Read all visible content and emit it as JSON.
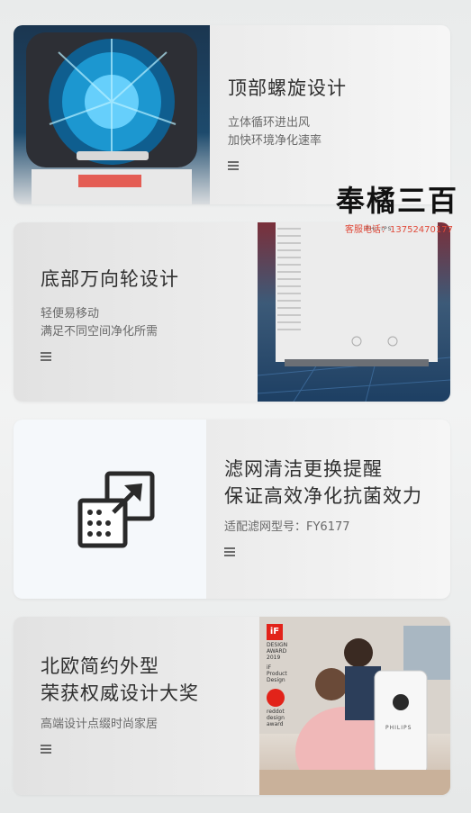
{
  "features": [
    {
      "title_lines": [
        "顶部螺旋设计"
      ],
      "desc_lines": [
        "立体循环进出风",
        "加快环境净化速率"
      ]
    },
    {
      "title_lines": [
        "底部万向轮设计"
      ],
      "desc_lines": [
        "轻便易移动",
        "满足不同空间净化所需"
      ]
    },
    {
      "title_lines": [
        "滤网清洁更换提醒",
        "保证高效净化抗菌效力"
      ],
      "desc_lines": [
        "适配滤网型号：FY6177"
      ]
    },
    {
      "title_lines": [
        "北欧简约外型",
        "荣获权威设计大奖"
      ],
      "desc_lines": [
        "高端设计点缀时尚家居"
      ]
    }
  ],
  "watermark": {
    "logo": "奉橘三百",
    "contact": "客服电话：13752470177"
  },
  "product_brand": "PHILIPS",
  "awards": {
    "if_mark": "iF",
    "if_lines": [
      "DESIGN",
      "AWARD",
      "2019"
    ],
    "if_product": [
      "iF",
      "Product",
      "Design"
    ],
    "reddot": [
      "reddot",
      "design",
      "award"
    ]
  },
  "colors": {
    "accent_red": "#e2231a",
    "fan_blue": "#1fa5e0"
  },
  "icons": [
    "menu-icon",
    "filter-replace-icon"
  ]
}
